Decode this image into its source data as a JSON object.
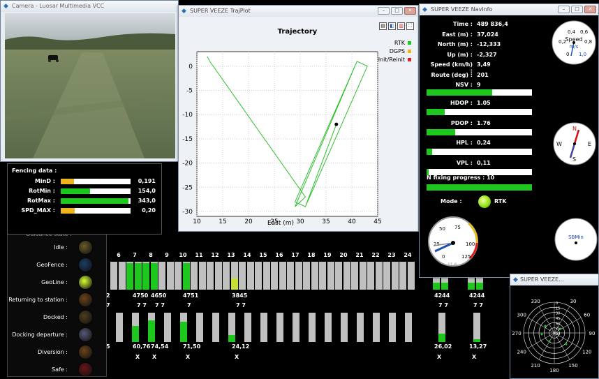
{
  "camera": {
    "title": "Camera - Luosar Multimedia VCC"
  },
  "fencing": {
    "title": "Fencing data :",
    "rows": [
      {
        "label": "MinD :",
        "value": "0,191",
        "fill": 0.19,
        "color": "#f0b420"
      },
      {
        "label": "RotMin :",
        "value": "154,0",
        "fill": 0.42,
        "color": "#1ec71e"
      },
      {
        "label": "RotMax :",
        "value": "343,0",
        "fill": 0.97,
        "color": "#1ec71e"
      },
      {
        "label": "SPD_MAX :",
        "value": "0,20",
        "fill": 0.2,
        "color": "#f0b420"
      }
    ]
  },
  "guidance": {
    "title": "Guidance state :",
    "rows": [
      {
        "label": "Idle :",
        "color": "#6b5a2a"
      },
      {
        "label": "GeoFence :",
        "color": "#1c3d66"
      },
      {
        "label": "GeoLine :",
        "color": "#d8ff30"
      },
      {
        "label": "Returning to station :",
        "color": "#6a4418"
      },
      {
        "label": "Docked :",
        "color": "#4d3f1e"
      },
      {
        "label": "Docking departure :",
        "color": "#59587a"
      },
      {
        "label": "Diversion :",
        "color": "#6a4418"
      },
      {
        "label": "Safe :",
        "color": "#6a1414"
      }
    ]
  },
  "traj": {
    "title": "SUPER VEEZE TrajPlot",
    "plot_title": "Trajectory",
    "xlabel": "East (m)",
    "xticks": [
      "10",
      "15",
      "20",
      "25",
      "30",
      "35",
      "40",
      "45"
    ],
    "yticks": [
      "0",
      "-5",
      "-10",
      "-15",
      "-20",
      "-25",
      "-30"
    ],
    "legend": [
      {
        "label": "RTK",
        "color": "#1ec71e"
      },
      {
        "label": "DGPS",
        "color": "#f0b420"
      },
      {
        "label": "Init/Reinit",
        "color": "#e02020"
      }
    ]
  },
  "chart_data": {
    "type": "line",
    "title": "Trajectory",
    "xlabel": "East (m)",
    "ylabel": "",
    "xlim": [
      10,
      45
    ],
    "ylim": [
      -31,
      3
    ],
    "series": [
      {
        "name": "RTK",
        "x": [
          12,
          12.5,
          31,
          29,
          41,
          43,
          31,
          29,
          41,
          43,
          31,
          29,
          41,
          43,
          31,
          37
        ],
        "y": [
          2,
          1,
          -27,
          -29,
          1,
          0,
          -29,
          -28,
          1,
          0,
          -29,
          -28,
          1,
          0,
          -29,
          -12
        ]
      }
    ],
    "marker": {
      "x": 37,
      "y": -12
    }
  },
  "nav": {
    "title": "SUPER VEEZE NavInfo",
    "rows": [
      {
        "label": "Time :",
        "value": "489 836,4"
      },
      {
        "label": "East (m) :",
        "value": "37,024"
      },
      {
        "label": "North (m) :",
        "value": "-12,333"
      },
      {
        "label": "Up (m) :",
        "value": "-2,327"
      },
      {
        "label": "Speed (km/h) :",
        "value": "3,49"
      },
      {
        "label": "Route (deg) :",
        "value": "201"
      },
      {
        "label": "NSV :",
        "value": "9"
      }
    ],
    "nsv_fill": 0.62,
    "dop": [
      {
        "label": "HDOP :",
        "value": "1.05",
        "fill": 0.17
      },
      {
        "label": "PDOP :",
        "value": "1.76",
        "fill": 0.27
      },
      {
        "label": "HPL :",
        "value": "0,24",
        "fill": 0.05
      },
      {
        "label": "VPL :",
        "value": "0,11",
        "fill": 0.02
      }
    ],
    "nfix": {
      "label": "N fixing progress :",
      "value": "10",
      "fill": 1.0
    },
    "mode": {
      "label": "Mode :",
      "value": "RTK"
    },
    "speed_gauge": {
      "label": "Speed",
      "unit": "m/s",
      "ticks": [
        "0,2",
        "0,4",
        "0,6",
        "0,8",
        "0",
        "1,0"
      ]
    },
    "compass": {
      "ticks": [
        "N",
        "E",
        "S",
        "W"
      ],
      "readout": "201"
    },
    "temp_gauge": {
      "ticks": [
        "25",
        "50",
        "75",
        "100",
        "0",
        "125"
      ],
      "readout": "11,6"
    },
    "sbm": {
      "label": "SBMin"
    }
  },
  "sats": {
    "numbers": [
      "6",
      "7",
      "8",
      "9",
      "10",
      "11",
      "12",
      "13",
      "14",
      "15",
      "16",
      "17",
      "18",
      "19",
      "20",
      "21",
      "22",
      "23",
      "24"
    ],
    "ids_bottom": [
      "2",
      "4750",
      "4650",
      "4751",
      "3845",
      "4244",
      "4244"
    ],
    "snr": [
      "5",
      "60,76",
      "74,54",
      "71,50",
      "24,12",
      "26,02",
      "13,27"
    ],
    "sevens": [
      "7",
      "7 7",
      "7 7",
      "7",
      "7 7",
      "7 7",
      "7 7"
    ],
    "x_mark": "X"
  },
  "polar": {
    "title": "SUPER VEEZE...",
    "angles": [
      "330",
      "30",
      "300",
      "60",
      "270",
      "90",
      "240",
      "120",
      "210",
      "150",
      "180"
    ],
    "rings": [
      "0",
      "15",
      "30",
      "45",
      "60",
      "75",
      "90"
    ]
  }
}
